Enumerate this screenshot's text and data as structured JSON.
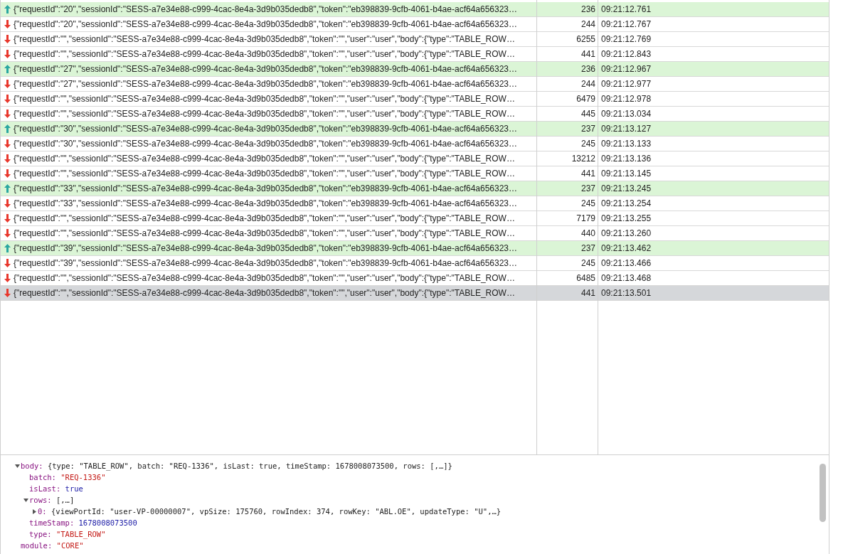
{
  "messages": [
    {
      "kind": "up",
      "selected": false,
      "text": "{\"requestId\":\"20\",\"sessionId\":\"SESS-a7e34e88-c999-4cac-8e4a-3d9b035dedb8\",\"token\":\"eb398839-9cfb-4061-b4ae-acf64a656323…",
      "size": "236",
      "time": "09:21:12.761"
    },
    {
      "kind": "down",
      "selected": false,
      "text": "{\"requestId\":\"20\",\"sessionId\":\"SESS-a7e34e88-c999-4cac-8e4a-3d9b035dedb8\",\"token\":\"eb398839-9cfb-4061-b4ae-acf64a656323…",
      "size": "244",
      "time": "09:21:12.767"
    },
    {
      "kind": "down",
      "selected": false,
      "text": "{\"requestId\":\"\",\"sessionId\":\"SESS-a7e34e88-c999-4cac-8e4a-3d9b035dedb8\",\"token\":\"\",\"user\":\"user\",\"body\":{\"type\":\"TABLE_ROW…",
      "size": "6255",
      "time": "09:21:12.769"
    },
    {
      "kind": "down",
      "selected": false,
      "text": "{\"requestId\":\"\",\"sessionId\":\"SESS-a7e34e88-c999-4cac-8e4a-3d9b035dedb8\",\"token\":\"\",\"user\":\"user\",\"body\":{\"type\":\"TABLE_ROW…",
      "size": "441",
      "time": "09:21:12.843"
    },
    {
      "kind": "up",
      "selected": false,
      "text": "{\"requestId\":\"27\",\"sessionId\":\"SESS-a7e34e88-c999-4cac-8e4a-3d9b035dedb8\",\"token\":\"eb398839-9cfb-4061-b4ae-acf64a656323…",
      "size": "236",
      "time": "09:21:12.967"
    },
    {
      "kind": "down",
      "selected": false,
      "text": "{\"requestId\":\"27\",\"sessionId\":\"SESS-a7e34e88-c999-4cac-8e4a-3d9b035dedb8\",\"token\":\"eb398839-9cfb-4061-b4ae-acf64a656323…",
      "size": "244",
      "time": "09:21:12.977"
    },
    {
      "kind": "down",
      "selected": false,
      "text": "{\"requestId\":\"\",\"sessionId\":\"SESS-a7e34e88-c999-4cac-8e4a-3d9b035dedb8\",\"token\":\"\",\"user\":\"user\",\"body\":{\"type\":\"TABLE_ROW…",
      "size": "6479",
      "time": "09:21:12.978"
    },
    {
      "kind": "down",
      "selected": false,
      "text": "{\"requestId\":\"\",\"sessionId\":\"SESS-a7e34e88-c999-4cac-8e4a-3d9b035dedb8\",\"token\":\"\",\"user\":\"user\",\"body\":{\"type\":\"TABLE_ROW…",
      "size": "445",
      "time": "09:21:13.034"
    },
    {
      "kind": "up",
      "selected": false,
      "text": "{\"requestId\":\"30\",\"sessionId\":\"SESS-a7e34e88-c999-4cac-8e4a-3d9b035dedb8\",\"token\":\"eb398839-9cfb-4061-b4ae-acf64a656323…",
      "size": "237",
      "time": "09:21:13.127"
    },
    {
      "kind": "down",
      "selected": false,
      "text": "{\"requestId\":\"30\",\"sessionId\":\"SESS-a7e34e88-c999-4cac-8e4a-3d9b035dedb8\",\"token\":\"eb398839-9cfb-4061-b4ae-acf64a656323…",
      "size": "245",
      "time": "09:21:13.133"
    },
    {
      "kind": "down",
      "selected": false,
      "text": "{\"requestId\":\"\",\"sessionId\":\"SESS-a7e34e88-c999-4cac-8e4a-3d9b035dedb8\",\"token\":\"\",\"user\":\"user\",\"body\":{\"type\":\"TABLE_ROW…",
      "size": "13212",
      "time": "09:21:13.136"
    },
    {
      "kind": "down",
      "selected": false,
      "text": "{\"requestId\":\"\",\"sessionId\":\"SESS-a7e34e88-c999-4cac-8e4a-3d9b035dedb8\",\"token\":\"\",\"user\":\"user\",\"body\":{\"type\":\"TABLE_ROW…",
      "size": "441",
      "time": "09:21:13.145"
    },
    {
      "kind": "up",
      "selected": false,
      "text": "{\"requestId\":\"33\",\"sessionId\":\"SESS-a7e34e88-c999-4cac-8e4a-3d9b035dedb8\",\"token\":\"eb398839-9cfb-4061-b4ae-acf64a656323…",
      "size": "237",
      "time": "09:21:13.245"
    },
    {
      "kind": "down",
      "selected": false,
      "text": "{\"requestId\":\"33\",\"sessionId\":\"SESS-a7e34e88-c999-4cac-8e4a-3d9b035dedb8\",\"token\":\"eb398839-9cfb-4061-b4ae-acf64a656323…",
      "size": "245",
      "time": "09:21:13.254"
    },
    {
      "kind": "down",
      "selected": false,
      "text": "{\"requestId\":\"\",\"sessionId\":\"SESS-a7e34e88-c999-4cac-8e4a-3d9b035dedb8\",\"token\":\"\",\"user\":\"user\",\"body\":{\"type\":\"TABLE_ROW…",
      "size": "7179",
      "time": "09:21:13.255"
    },
    {
      "kind": "down",
      "selected": false,
      "text": "{\"requestId\":\"\",\"sessionId\":\"SESS-a7e34e88-c999-4cac-8e4a-3d9b035dedb8\",\"token\":\"\",\"user\":\"user\",\"body\":{\"type\":\"TABLE_ROW…",
      "size": "440",
      "time": "09:21:13.260"
    },
    {
      "kind": "up",
      "selected": false,
      "text": "{\"requestId\":\"39\",\"sessionId\":\"SESS-a7e34e88-c999-4cac-8e4a-3d9b035dedb8\",\"token\":\"eb398839-9cfb-4061-b4ae-acf64a656323…",
      "size": "237",
      "time": "09:21:13.462"
    },
    {
      "kind": "down",
      "selected": false,
      "text": "{\"requestId\":\"39\",\"sessionId\":\"SESS-a7e34e88-c999-4cac-8e4a-3d9b035dedb8\",\"token\":\"eb398839-9cfb-4061-b4ae-acf64a656323…",
      "size": "245",
      "time": "09:21:13.466"
    },
    {
      "kind": "down",
      "selected": false,
      "text": "{\"requestId\":\"\",\"sessionId\":\"SESS-a7e34e88-c999-4cac-8e4a-3d9b035dedb8\",\"token\":\"\",\"user\":\"user\",\"body\":{\"type\":\"TABLE_ROW…",
      "size": "6485",
      "time": "09:21:13.468"
    },
    {
      "kind": "down",
      "selected": true,
      "text": "{\"requestId\":\"\",\"sessionId\":\"SESS-a7e34e88-c999-4cac-8e4a-3d9b035dedb8\",\"token\":\"\",\"user\":\"user\",\"body\":{\"type\":\"TABLE_ROW…",
      "size": "441",
      "time": "09:21:13.501"
    }
  ],
  "detail": [
    {
      "key": "body:",
      "kind": "object",
      "preview": "{type: \"TABLE_ROW\", batch: \"REQ-1336\", isLast: true, timeStamp: 1678008073500, rows: [,…]}",
      "expanded": true,
      "children": [
        {
          "key": "batch:",
          "kind": "string",
          "value": "\"REQ-1336\""
        },
        {
          "key": "isLast:",
          "kind": "literal",
          "value": "true"
        },
        {
          "key": "rows:",
          "kind": "object",
          "preview": "[,…]",
          "expanded": true,
          "children": [
            {
              "key": "0:",
              "kind": "object",
              "preview": "{viewPortId: \"user-VP-00000007\", vpSize: 175760, rowIndex: 374, rowKey: \"ABL.OE\", updateType: \"U\",…}",
              "expanded": false
            }
          ]
        },
        {
          "key": "timeStamp:",
          "kind": "literal",
          "value": "1678008073500"
        },
        {
          "key": "type:",
          "kind": "string",
          "value": "\"TABLE_ROW\""
        }
      ]
    },
    {
      "key": "module:",
      "kind": "string",
      "value": "\"CORE\""
    }
  ]
}
